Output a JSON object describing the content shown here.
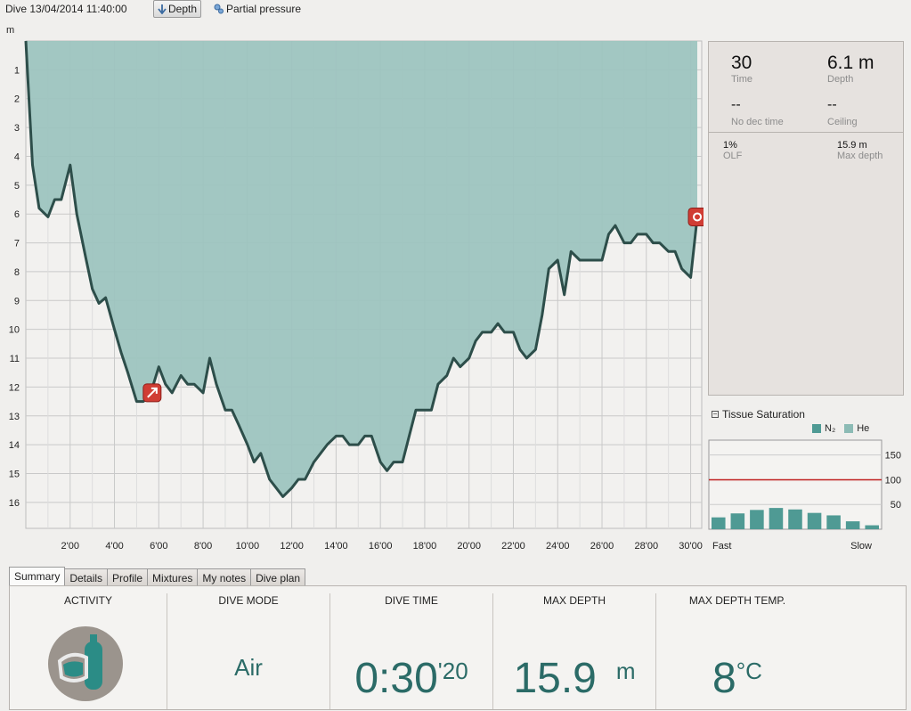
{
  "toolbar": {
    "title": "Dive 13/04/2014 11:40:00",
    "depth_label": "Depth",
    "pp_label": "Partial pressure"
  },
  "chart_data": {
    "type": "area",
    "ylabel": "m",
    "ylim": [
      0,
      16.9
    ],
    "xlim": [
      0,
      30.5
    ],
    "y_ticks": [
      "1",
      "2",
      "3",
      "4",
      "5",
      "6",
      "7",
      "8",
      "9",
      "10",
      "11",
      "12",
      "13",
      "14",
      "15",
      "16"
    ],
    "x_ticks": [
      "2'00",
      "4'00",
      "6'00",
      "8'00",
      "10'00",
      "12'00",
      "14'00",
      "16'00",
      "18'00",
      "20'00",
      "22'00",
      "24'00",
      "26'00",
      "28'00",
      "30'00"
    ],
    "grid": true,
    "fill_color": "#9dc4bf",
    "line_color": "#2d4e4a",
    "series": [
      {
        "x": [
          0,
          0.3,
          0.6,
          1.0,
          1.3,
          1.6,
          2.0,
          2.3,
          2.7,
          3.0,
          3.3,
          3.6,
          4.0,
          4.3,
          4.6,
          5.0,
          5.3,
          5.6,
          6.0,
          6.3,
          6.6,
          7.0,
          7.3,
          7.6,
          8.0,
          8.3,
          8.6,
          9.0,
          9.3,
          9.6,
          10.0,
          10.3,
          10.6,
          11.0,
          11.3,
          11.6,
          12.0,
          12.3,
          12.6,
          13.0,
          13.3,
          13.6,
          14.0,
          14.3,
          14.6,
          15.0,
          15.3,
          15.6,
          16.0,
          16.3,
          16.6,
          17.0,
          17.3,
          17.6,
          18.0,
          18.3,
          18.6,
          19.0,
          19.3,
          19.6,
          20.0,
          20.3,
          20.6,
          21.0,
          21.3,
          21.6,
          22.0,
          22.3,
          22.6,
          23.0,
          23.3,
          23.6,
          24.0,
          24.3,
          24.6,
          25.0,
          25.3,
          25.6,
          26.0,
          26.3,
          26.6,
          27.0,
          27.3,
          27.6,
          28.0,
          28.3,
          28.6,
          29.0,
          29.3,
          29.6,
          30.0,
          30.3
        ],
        "y": [
          0,
          4.3,
          5.8,
          6.1,
          5.5,
          5.5,
          4.3,
          6.0,
          7.5,
          8.6,
          9.1,
          8.9,
          10.0,
          10.8,
          11.5,
          12.5,
          12.5,
          12.3,
          11.3,
          11.9,
          12.2,
          11.6,
          11.9,
          11.9,
          12.2,
          11.0,
          11.9,
          12.8,
          12.8,
          13.3,
          14.0,
          14.6,
          14.3,
          15.2,
          15.5,
          15.8,
          15.5,
          15.2,
          15.2,
          14.6,
          14.3,
          14.0,
          13.7,
          13.7,
          14.0,
          14.0,
          13.7,
          13.7,
          14.6,
          14.9,
          14.6,
          14.6,
          13.7,
          12.8,
          12.8,
          12.8,
          11.9,
          11.6,
          11.0,
          11.3,
          11.0,
          10.4,
          10.1,
          10.1,
          9.8,
          10.1,
          10.1,
          10.7,
          11.0,
          10.7,
          9.5,
          7.9,
          7.6,
          8.8,
          7.3,
          7.6,
          7.6,
          7.6,
          7.6,
          6.7,
          6.4,
          7.0,
          7.0,
          6.7,
          6.7,
          7.0,
          7.0,
          7.3,
          7.3,
          7.9,
          8.2,
          6.1
        ]
      }
    ],
    "markers": [
      {
        "x": 5.7,
        "y": 12.2,
        "icon": "ascent-arrow-icon",
        "color": "#d03d34"
      },
      {
        "x": 30.3,
        "y": 6.1,
        "icon": "end-marker-icon",
        "color": "#d03d34"
      }
    ]
  },
  "panel": {
    "time_value": "30",
    "time_label": "Time",
    "depth_value": "6.1 m",
    "depth_label": "Depth",
    "nodec_value": "--",
    "nodec_label": "No dec time",
    "ceiling_value": "--",
    "ceiling_label": "Ceiling",
    "olf_value": "1%",
    "olf_label": "OLF",
    "maxdepth_value": "15.9 m",
    "maxdepth_label": "Max depth"
  },
  "tissue": {
    "title": "Tissue Saturation",
    "collapse_glyph": "−",
    "legend_n2": "N₂",
    "legend_he": "He",
    "n2_color": "#4f9a94",
    "he_color": "#8cbbb5",
    "limit_color": "#c02020",
    "y_ticks": [
      "150",
      "100",
      "50"
    ],
    "limit": 100,
    "bars": [
      24,
      32,
      39,
      43,
      40,
      33,
      28,
      16,
      8
    ],
    "fast_label": "Fast",
    "slow_label": "Slow"
  },
  "tabs": [
    "Summary",
    "Details",
    "Profile",
    "Mixtures",
    "My notes",
    "Dive plan"
  ],
  "summary": {
    "activity_hdr": "ACTIVITY",
    "mode_hdr": "DIVE MODE",
    "mode_value": "Air",
    "time_hdr": "DIVE TIME",
    "time_main": "0:30",
    "time_sec": "'20",
    "maxdepth_hdr": "MAX DEPTH",
    "maxdepth_value": "15.9",
    "maxdepth_unit": "m",
    "temp_hdr": "MAX DEPTH TEMP.",
    "temp_value": "8",
    "temp_unit": "°C",
    "accent": "#2b6b67"
  }
}
